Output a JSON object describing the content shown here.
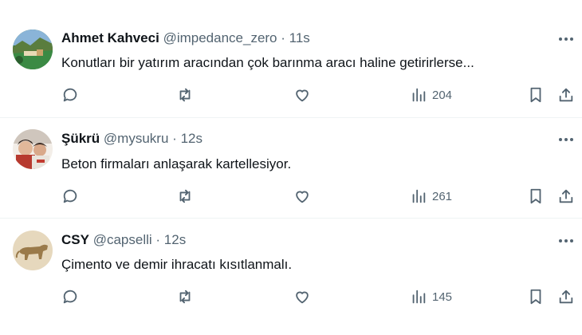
{
  "colors": {
    "text": "#0f1419",
    "secondary": "#536471",
    "divider": "#eff3f4"
  },
  "icons": [
    "more-icon",
    "reply-icon",
    "retweet-icon",
    "like-icon",
    "views-icon",
    "bookmark-icon",
    "share-icon"
  ],
  "tweets": [
    {
      "name": "Ahmet Kahveci",
      "handle": "@impedance_zero",
      "separator": "·",
      "time": "11s",
      "text": "Konutları bir yatırım aracından çok barınma aracı haline getirirlerse...",
      "views": "204"
    },
    {
      "name": "Şükrü",
      "handle": "@mysukru",
      "separator": "·",
      "time": "12s",
      "text": "Beton firmaları anlaşarak kartellesiyor.",
      "views": "261"
    },
    {
      "name": "CSY",
      "handle": "@capselli",
      "separator": "·",
      "time": "12s",
      "text": "Çimento ve demir ihracatı kısıtlanmalı.",
      "views": "145"
    }
  ]
}
